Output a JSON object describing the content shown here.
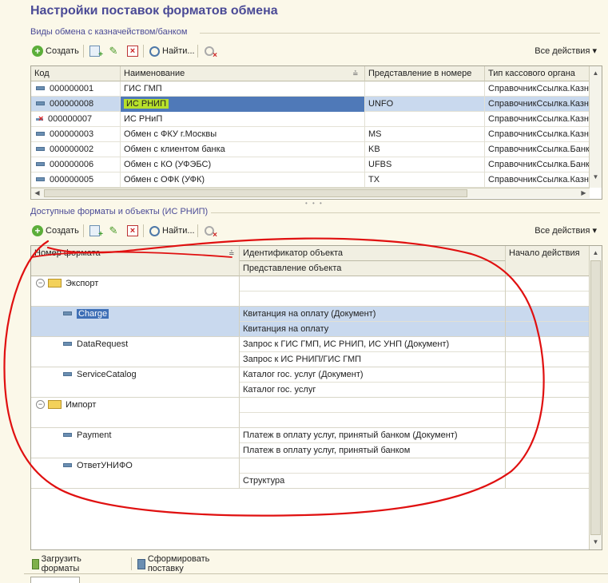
{
  "window": {
    "title": "Настройки поставок форматов обмена"
  },
  "top_section": {
    "label": "Виды обмена с казначейством/банком",
    "toolbar": {
      "create": "Создать",
      "find": "Найти...",
      "all_actions": "Все действия",
      "copy_icon": "copy-add-icon",
      "edit_icon": "pencil-icon",
      "delete_icon": "delete-icon",
      "clear_icon": "clear-search-icon"
    },
    "columns": [
      "Код",
      "Наименование",
      "Представление в номере",
      "Тип кассового органа"
    ],
    "rows": [
      {
        "code": "000000001",
        "name": "ГИС ГМП",
        "repr": "",
        "type": "СправочникСсылка.Казн",
        "state": "normal"
      },
      {
        "code": "000000008",
        "name": "ИС РНИП",
        "repr": "UNFO",
        "type": "СправочникСсылка.Казн",
        "state": "selected"
      },
      {
        "code": "000000007",
        "name": "ИС РНиП",
        "repr": "",
        "type": "СправочникСсылка.Казн",
        "state": "deleted"
      },
      {
        "code": "000000003",
        "name": "Обмен с ФКУ г.Москвы",
        "repr": "MS",
        "type": "СправочникСсылка.Казн",
        "state": "normal"
      },
      {
        "code": "000000002",
        "name": "Обмен с клиентом банка",
        "repr": "KB",
        "type": "СправочникСсылка.Банк",
        "state": "normal"
      },
      {
        "code": "000000006",
        "name": "Обмен с КО (УФЭБС)",
        "repr": "UFBS",
        "type": "СправочникСсылка.Банк",
        "state": "normal"
      },
      {
        "code": "000000005",
        "name": "Обмен с ОФК (УФК)",
        "repr": "TX",
        "type": "СправочникСсылка.Казн",
        "state": "normal"
      }
    ]
  },
  "bottom_section": {
    "label": "Доступные форматы и объекты (ИС РНИП)",
    "toolbar": {
      "create": "Создать",
      "find": "Найти...",
      "all_actions": "Все действия"
    },
    "columns": {
      "format_number": "Номер формата",
      "object_id": "Идентификатор объекта",
      "object_repr": "Представление объекта",
      "start": "Начало действия"
    },
    "rows": [
      {
        "level": 0,
        "name": "Экспорт",
        "id": "",
        "repr": "",
        "start": ""
      },
      {
        "level": 1,
        "name": "Charge",
        "id": "Квитанция на оплату (Документ)",
        "repr": "Квитанция на оплату",
        "start": "",
        "selected": true
      },
      {
        "level": 1,
        "name": "DataRequest",
        "id": "Запрос к ГИС ГМП, ИС РНИП, ИС УНП (Документ)",
        "repr": "Запрос к ИС РНИП/ГИС ГМП",
        "start": ""
      },
      {
        "level": 1,
        "name": "ServiceCatalog",
        "id": "Каталог гос. услуг (Документ)",
        "repr": "Каталог гос. услуг",
        "start": ""
      },
      {
        "level": 0,
        "name": "Импорт",
        "id": "",
        "repr": "",
        "start": ""
      },
      {
        "level": 1,
        "name": "Payment",
        "id": "Платеж в оплату услуг, принятый банком (Документ)",
        "repr": "Платеж в оплату услуг, принятый банком",
        "start": ""
      },
      {
        "level": 2,
        "name": "ОтветУНИФО",
        "id": "",
        "repr": "Структура",
        "start": ""
      }
    ]
  },
  "footer": {
    "load_formats": "Загрузить форматы",
    "build_delivery": "Сформировать поставку"
  },
  "colors": {
    "title": "#4a4a96",
    "selection": "#c9d9ee",
    "highlight": "#b7e02a",
    "annotation": "#e01010"
  }
}
